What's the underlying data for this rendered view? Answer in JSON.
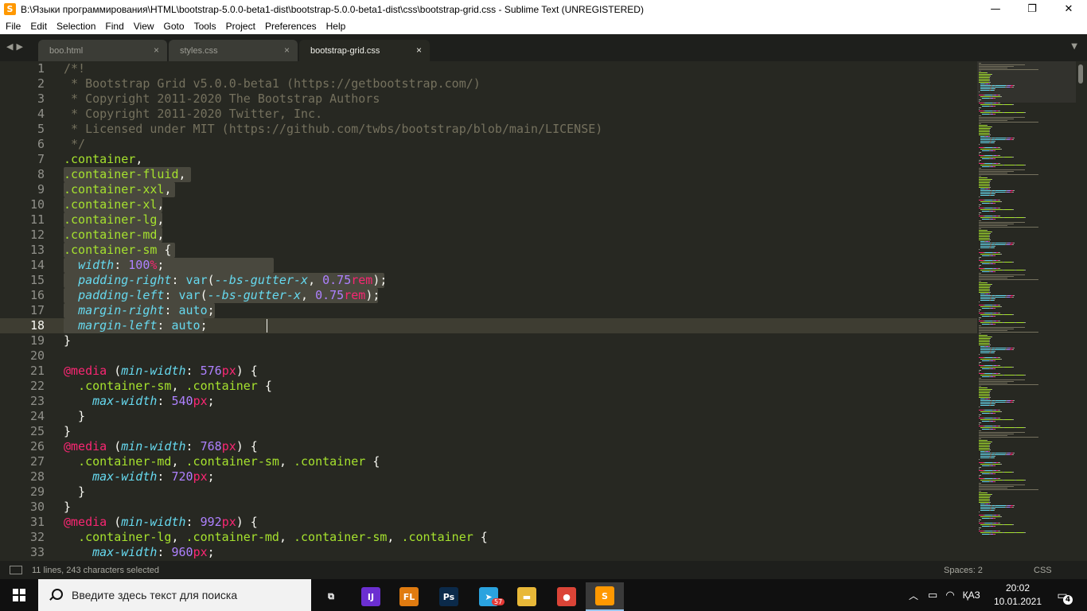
{
  "window": {
    "title": "B:\\Языки программирования\\HTML\\bootstrap-5.0.0-beta1-dist\\bootstrap-5.0.0-beta1-dist\\css\\bootstrap-grid.css - Sublime Text (UNREGISTERED)",
    "app_icon": "S",
    "minimize": "—",
    "maximize": "❐",
    "close": "✕"
  },
  "menu": [
    "File",
    "Edit",
    "Selection",
    "Find",
    "View",
    "Goto",
    "Tools",
    "Project",
    "Preferences",
    "Help"
  ],
  "tabs": [
    {
      "label": "boo.html",
      "close": "×",
      "active": false
    },
    {
      "label": "styles.css",
      "close": "×",
      "active": false
    },
    {
      "label": "bootstrap-grid.css",
      "close": "×",
      "active": true
    }
  ],
  "nav_arrows": "◀▶",
  "tab_dropdown": "▼",
  "line_numbers": [
    "1",
    "2",
    "3",
    "4",
    "5",
    "6",
    "7",
    "8",
    "9",
    "10",
    "11",
    "12",
    "13",
    "14",
    "15",
    "16",
    "17",
    "18",
    "19",
    "20",
    "21",
    "22",
    "23",
    "24",
    "25",
    "26",
    "27",
    "28",
    "29",
    "30",
    "31",
    "32",
    "33"
  ],
  "current_line": "18",
  "code_lines": [
    [
      [
        "c",
        "/*!"
      ]
    ],
    [
      [
        "c",
        " * Bootstrap Grid v5.0.0-beta1 (https://getbootstrap.com/)"
      ]
    ],
    [
      [
        "c",
        " * Copyright 2011-2020 The Bootstrap Authors"
      ]
    ],
    [
      [
        "c",
        " * Copyright 2011-2020 Twitter, Inc."
      ]
    ],
    [
      [
        "c",
        " * Licensed under MIT (https://github.com/twbs/bootstrap/blob/main/LICENSE)"
      ]
    ],
    [
      [
        "c",
        " */"
      ]
    ],
    [
      [
        "s",
        ".container"
      ],
      [
        "w",
        ","
      ]
    ],
    [
      [
        "s",
        ".container-fluid"
      ],
      [
        "w",
        ","
      ]
    ],
    [
      [
        "s",
        ".container-xxl"
      ],
      [
        "w",
        ","
      ]
    ],
    [
      [
        "s",
        ".container-xl"
      ],
      [
        "w",
        ","
      ]
    ],
    [
      [
        "s",
        ".container-lg"
      ],
      [
        "w",
        ","
      ]
    ],
    [
      [
        "s",
        ".container-md"
      ],
      [
        "w",
        ","
      ]
    ],
    [
      [
        "s",
        ".container-sm"
      ],
      [
        "w",
        " {"
      ]
    ],
    [
      [
        "w",
        "  "
      ],
      [
        "p",
        "width"
      ],
      [
        "w",
        ": "
      ],
      [
        "n",
        "100"
      ],
      [
        "u",
        "%"
      ],
      [
        "w",
        ";"
      ]
    ],
    [
      [
        "w",
        "  "
      ],
      [
        "p",
        "padding-right"
      ],
      [
        "w",
        ": "
      ],
      [
        "f",
        "var"
      ],
      [
        "w",
        "("
      ],
      [
        "p",
        "--bs-gutter-x"
      ],
      [
        "w",
        ", "
      ],
      [
        "n",
        "0.75"
      ],
      [
        "u",
        "rem"
      ],
      [
        "w",
        ");"
      ]
    ],
    [
      [
        "w",
        "  "
      ],
      [
        "p",
        "padding-left"
      ],
      [
        "w",
        ": "
      ],
      [
        "f",
        "var"
      ],
      [
        "w",
        "("
      ],
      [
        "p",
        "--bs-gutter-x"
      ],
      [
        "w",
        ", "
      ],
      [
        "n",
        "0.75"
      ],
      [
        "u",
        "rem"
      ],
      [
        "w",
        ");"
      ]
    ],
    [
      [
        "w",
        "  "
      ],
      [
        "p",
        "margin-right"
      ],
      [
        "w",
        ": "
      ],
      [
        "f",
        "auto"
      ],
      [
        "w",
        ";"
      ]
    ],
    [
      [
        "w",
        "  "
      ],
      [
        "p",
        "margin-left"
      ],
      [
        "w",
        ": "
      ],
      [
        "f",
        "auto"
      ],
      [
        "w",
        ";"
      ]
    ],
    [
      [
        "w",
        "}"
      ]
    ],
    [
      [
        "w",
        ""
      ]
    ],
    [
      [
        "k",
        "@media"
      ],
      [
        "w",
        " ("
      ],
      [
        "p",
        "min-width"
      ],
      [
        "w",
        ": "
      ],
      [
        "n",
        "576"
      ],
      [
        "u",
        "px"
      ],
      [
        "w",
        ") {"
      ]
    ],
    [
      [
        "w",
        "  "
      ],
      [
        "s",
        ".container-sm"
      ],
      [
        "w",
        ", "
      ],
      [
        "s",
        ".container"
      ],
      [
        "w",
        " {"
      ]
    ],
    [
      [
        "w",
        "    "
      ],
      [
        "p",
        "max-width"
      ],
      [
        "w",
        ": "
      ],
      [
        "n",
        "540"
      ],
      [
        "u",
        "px"
      ],
      [
        "w",
        ";"
      ]
    ],
    [
      [
        "w",
        "  }"
      ]
    ],
    [
      [
        "w",
        "}"
      ]
    ],
    [
      [
        "k",
        "@media"
      ],
      [
        "w",
        " ("
      ],
      [
        "p",
        "min-width"
      ],
      [
        "w",
        ": "
      ],
      [
        "n",
        "768"
      ],
      [
        "u",
        "px"
      ],
      [
        "w",
        ") {"
      ]
    ],
    [
      [
        "w",
        "  "
      ],
      [
        "s",
        ".container-md"
      ],
      [
        "w",
        ", "
      ],
      [
        "s",
        ".container-sm"
      ],
      [
        "w",
        ", "
      ],
      [
        "s",
        ".container"
      ],
      [
        "w",
        " {"
      ]
    ],
    [
      [
        "w",
        "    "
      ],
      [
        "p",
        "max-width"
      ],
      [
        "w",
        ": "
      ],
      [
        "n",
        "720"
      ],
      [
        "u",
        "px"
      ],
      [
        "w",
        ";"
      ]
    ],
    [
      [
        "w",
        "  }"
      ]
    ],
    [
      [
        "w",
        "}"
      ]
    ],
    [
      [
        "k",
        "@media"
      ],
      [
        "w",
        " ("
      ],
      [
        "p",
        "min-width"
      ],
      [
        "w",
        ": "
      ],
      [
        "n",
        "992"
      ],
      [
        "u",
        "px"
      ],
      [
        "w",
        ") {"
      ]
    ],
    [
      [
        "w",
        "  "
      ],
      [
        "s",
        ".container-lg"
      ],
      [
        "w",
        ", "
      ],
      [
        "s",
        ".container-md"
      ],
      [
        "w",
        ", "
      ],
      [
        "s",
        ".container-sm"
      ],
      [
        "w",
        ", "
      ],
      [
        "s",
        ".container"
      ],
      [
        "w",
        " {"
      ]
    ],
    [
      [
        "w",
        "    "
      ],
      [
        "p",
        "max-width"
      ],
      [
        "w",
        ": "
      ],
      [
        "n",
        "960"
      ],
      [
        "u",
        "px"
      ],
      [
        "w",
        ";"
      ]
    ]
  ],
  "status": {
    "selection": "11 lines, 243 characters selected",
    "indent": "Spaces: 2",
    "syntax": "CSS"
  },
  "taskbar": {
    "search_placeholder": "Введите здесь текст для поиска",
    "apps": [
      {
        "name": "task-view",
        "glyph": "⧉",
        "color": "#101010"
      },
      {
        "name": "intellij",
        "glyph": "IJ",
        "color": "#6b2fd1"
      },
      {
        "name": "fl-studio",
        "glyph": "FL",
        "color": "#e07b10"
      },
      {
        "name": "photoshop",
        "glyph": "Ps",
        "color": "#0b2a4a"
      },
      {
        "name": "telegram",
        "glyph": "➤",
        "color": "#2aa3df",
        "badge": "57"
      },
      {
        "name": "file-explorer",
        "glyph": "▬",
        "color": "#e8b838"
      },
      {
        "name": "chrome",
        "glyph": "●",
        "color": "#db4437"
      },
      {
        "name": "sublime-text",
        "glyph": "S",
        "color": "#ff9800"
      }
    ],
    "tray_chevron": "︿",
    "language": "ҚАЗ",
    "time": "20:02",
    "date": "10.01.2021",
    "notifications": "4"
  }
}
